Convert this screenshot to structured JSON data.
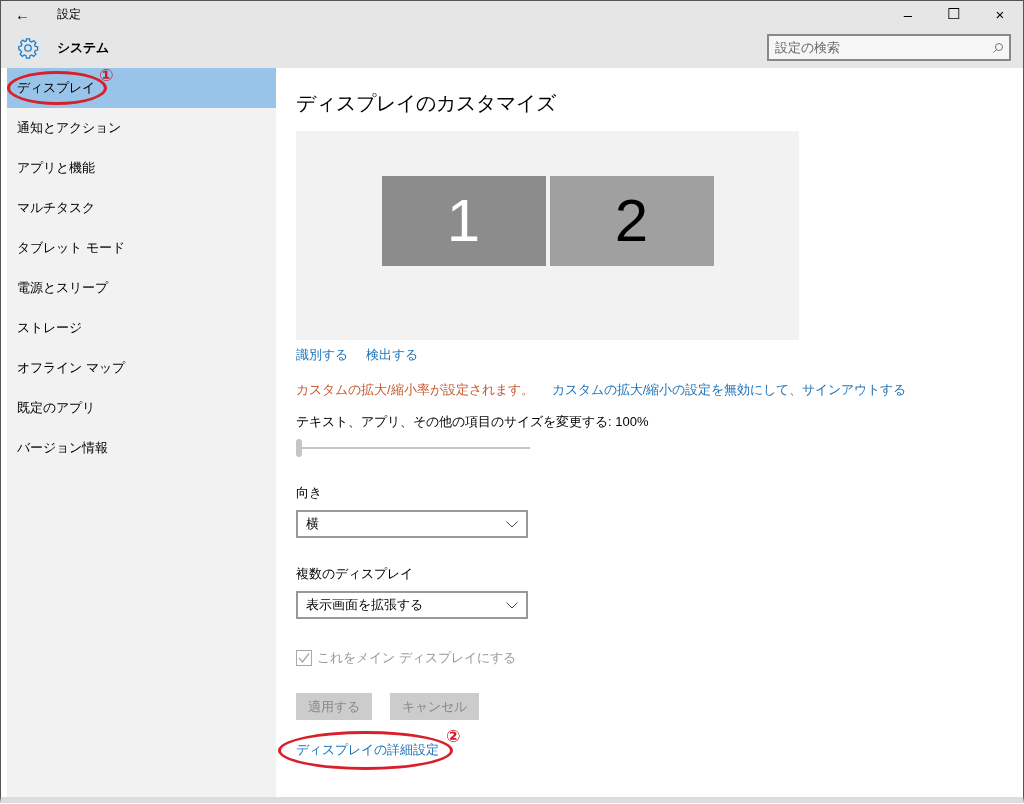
{
  "window": {
    "title": "設定",
    "back": "←",
    "controls": [
      "–",
      "☐",
      "×"
    ]
  },
  "header": {
    "title": "システム",
    "search": {
      "placeholder": "設定の検索"
    }
  },
  "sidebar": {
    "items": [
      {
        "label": "ディスプレイ",
        "selected": true,
        "annotation": "①"
      },
      {
        "label": "通知とアクション",
        "selected": false
      },
      {
        "label": "アプリと機能",
        "selected": false
      },
      {
        "label": "マルチタスク",
        "selected": false
      },
      {
        "label": "タブレット モード",
        "selected": false
      },
      {
        "label": "電源とスリープ",
        "selected": false
      },
      {
        "label": "ストレージ",
        "selected": false
      },
      {
        "label": "オフライン マップ",
        "selected": false
      },
      {
        "label": "既定のアプリ",
        "selected": false
      },
      {
        "label": "バージョン情報",
        "selected": false
      }
    ]
  },
  "main": {
    "title": "ディスプレイのカスタマイズ",
    "monitors": [
      {
        "label": "1",
        "selected": true
      },
      {
        "label": "2",
        "selected": false
      }
    ],
    "links": [
      "識別する",
      "検出する"
    ],
    "warning": "カスタムの拡大/縮小率が設定されます。",
    "signout_link": "カスタムの拡大/縮小の設定を無効にして、サインアウトする",
    "scale": {
      "label": "テキスト、アプリ、その他の項目のサイズを変更する: 100%",
      "level": 0
    },
    "orientation": {
      "label": "向き",
      "value": "横"
    },
    "multiple": {
      "label": "複数のディスプレイ",
      "value": "表示画面を拡張する"
    },
    "main_display": {
      "label": "これをメイン ディスプレイにする",
      "checked": true,
      "disabled": true
    },
    "buttons": [
      {
        "label": "適用する",
        "disabled": true
      },
      {
        "label": "キャンセル",
        "disabled": true
      }
    ],
    "advanced_link": {
      "label": "ディスプレイの詳細設定",
      "annotation": "②"
    }
  }
}
